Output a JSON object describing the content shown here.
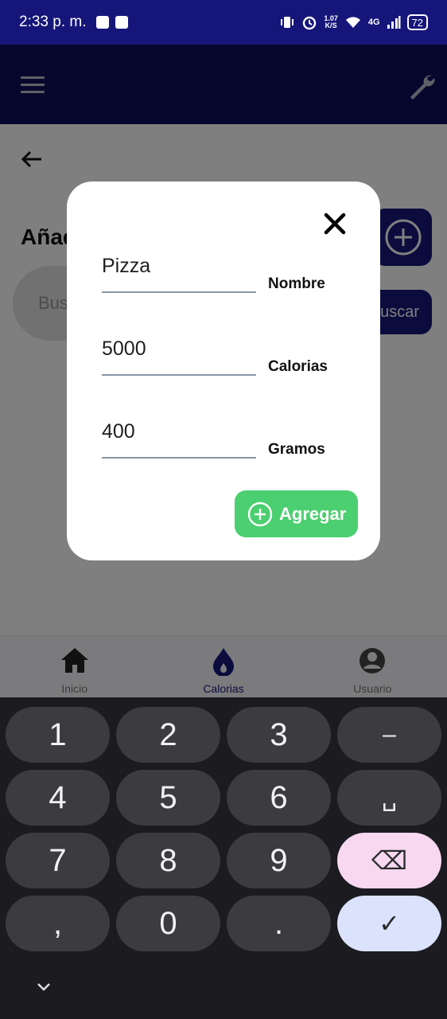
{
  "status_bar": {
    "time": "2:33 p. m.",
    "speed_value": "1.07",
    "speed_unit": "K/S",
    "network": "4G",
    "battery": "72"
  },
  "page": {
    "title": "Añad",
    "search_placeholder": "Bus",
    "buscar_label": "uscar"
  },
  "dialog": {
    "fields": [
      {
        "value": "Pizza",
        "label": "Nombre"
      },
      {
        "value": "5000",
        "label": "Calorias"
      },
      {
        "value": "400",
        "label": "Gramos"
      }
    ],
    "add_button": "Agregar"
  },
  "bottom_nav": {
    "items": [
      {
        "label": "Inicio",
        "icon": "home-icon"
      },
      {
        "label": "Calorias",
        "icon": "flame-icon",
        "active": true
      },
      {
        "label": "Usuario",
        "icon": "account-circle-icon"
      }
    ]
  },
  "keyboard": {
    "keys": [
      "1",
      "2",
      "3",
      "–",
      "4",
      "5",
      "6",
      "␣",
      "7",
      "8",
      "9",
      "⌫",
      ",",
      "0",
      ".",
      "✓"
    ]
  },
  "colors": {
    "primary": "#16167a",
    "accent_green": "#4ccf70"
  }
}
